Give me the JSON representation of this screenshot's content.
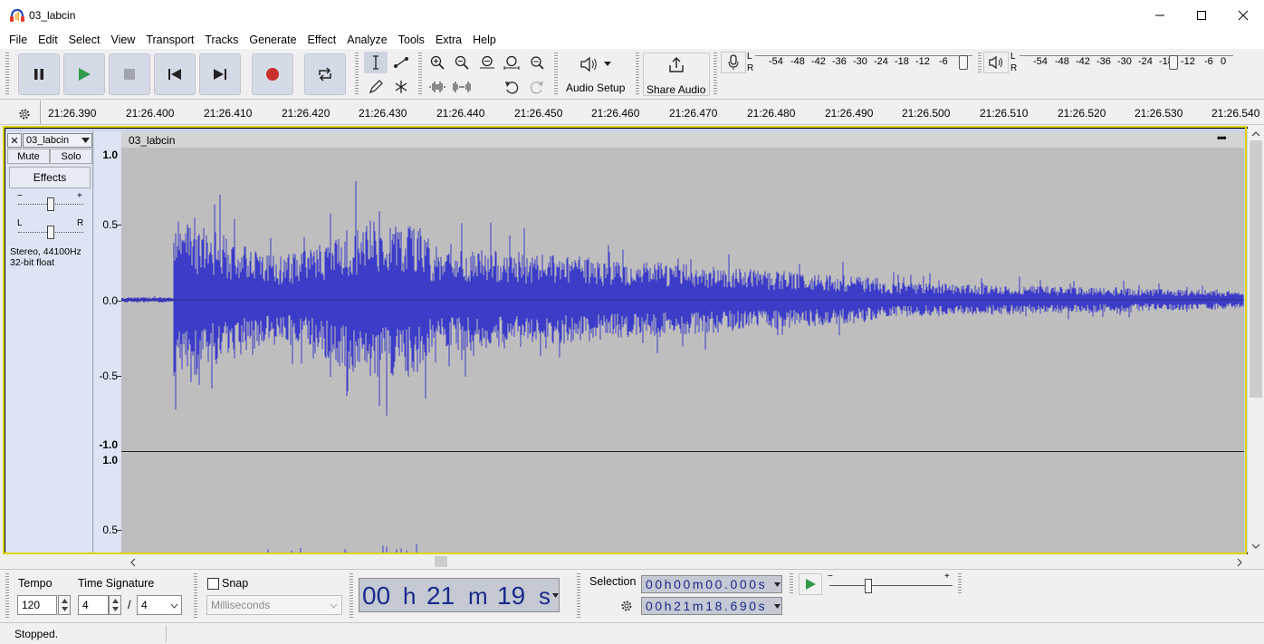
{
  "window": {
    "title": "03_labcin",
    "minimize": "—",
    "maximize": "☐",
    "close": "✕"
  },
  "menu": [
    "File",
    "Edit",
    "Select",
    "View",
    "Transport",
    "Tracks",
    "Generate",
    "Effect",
    "Analyze",
    "Tools",
    "Extra",
    "Help"
  ],
  "toolbar": {
    "audio_setup_label": "Audio Setup",
    "share_audio_label": "Share Audio",
    "rec_meter_channels": [
      "L",
      "R"
    ],
    "rec_meter_scale": [
      "-54",
      "-48",
      "-42",
      "-36",
      "-30",
      "-24",
      "-18",
      "-12",
      "-6",
      "0"
    ],
    "play_meter_scale": [
      "-54",
      "-48",
      "-42",
      "-36",
      "-30",
      "-24",
      "-18",
      "-12",
      "-6",
      "0"
    ]
  },
  "timeline": {
    "ticks": [
      "21:26.390",
      "21:26.400",
      "21:26.410",
      "21:26.420",
      "21:26.430",
      "21:26.440",
      "21:26.450",
      "21:26.460",
      "21:26.470",
      "21:26.480",
      "21:26.490",
      "21:26.500",
      "21:26.510",
      "21:26.520",
      "21:26.530",
      "21:26.540"
    ]
  },
  "track": {
    "name": "03_labcin",
    "close_label": "✕",
    "mute_label": "Mute",
    "solo_label": "Solo",
    "effects_label": "Effects",
    "gain_minus": "−",
    "gain_plus": "+",
    "pan_left": "L",
    "pan_right": "R",
    "info_line1": "Stereo, 44100Hz",
    "info_line2": "32-bit float",
    "clip_title": "03_labcin",
    "clip_menu": "•••",
    "ruler_top": [
      "1.0",
      "0.5",
      "0.0",
      "-0.5",
      "-1.0"
    ],
    "ruler_bottom": [
      "1.0",
      "0.5"
    ],
    "wave_color": "#3c3cc8"
  },
  "bottom": {
    "tempo_label": "Tempo",
    "tempo_value": "120",
    "time_signature_label": "Time Signature",
    "ts_numerator": "4",
    "ts_separator": "/",
    "ts_denominator": "4",
    "snap_label": "Snap",
    "snap_unit": "Milliseconds",
    "time_display": [
      "00",
      "h",
      "21",
      "m",
      "19",
      "s"
    ],
    "selection_label": "Selection",
    "selection_start": "00h00m00.000s",
    "selection_end": "00h21m18.690s"
  },
  "status": {
    "text": "Stopped."
  }
}
